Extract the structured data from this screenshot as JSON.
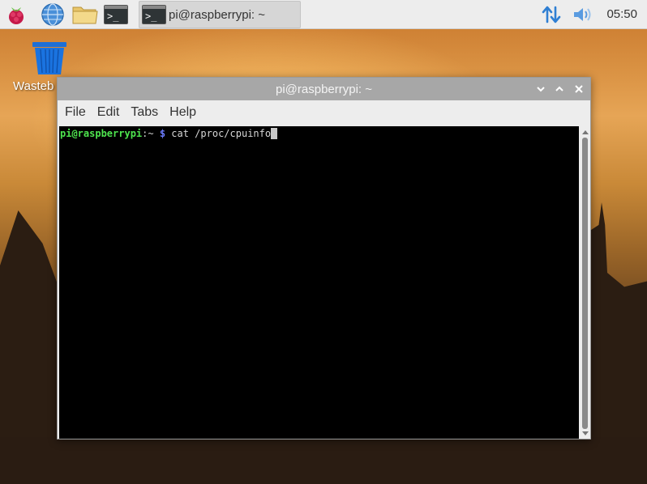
{
  "taskbar": {
    "launchers": [
      {
        "name": "raspberry-menu-icon"
      },
      {
        "name": "web-browser-icon"
      },
      {
        "name": "file-manager-icon"
      },
      {
        "name": "terminal-icon",
        "glyph": ">_"
      }
    ],
    "task": {
      "title": "pi@raspberrypi: ~",
      "glyph": ">_"
    },
    "tray": {
      "network": "network-updown-icon",
      "volume": "volume-icon"
    },
    "clock": "05:50"
  },
  "desktop": {
    "icons": [
      {
        "label": "Wastebasket",
        "visible_label": "Wasteb",
        "icon": "trash-icon"
      }
    ]
  },
  "window": {
    "title": "pi@raspberrypi: ~",
    "controls": [
      "minimize-icon",
      "maximize-icon",
      "close-icon"
    ],
    "menu": [
      "File",
      "Edit",
      "Tabs",
      "Help"
    ],
    "terminal": {
      "prompt_user": "pi@raspberrypi",
      "prompt_sep": ":~",
      "prompt_symbol": " $",
      "command": " cat /proc/cpuinfo"
    }
  },
  "colors": {
    "accent": "#3b8ee0",
    "prompt_green": "#4ee44e",
    "prompt_blue": "#6c7cff"
  }
}
